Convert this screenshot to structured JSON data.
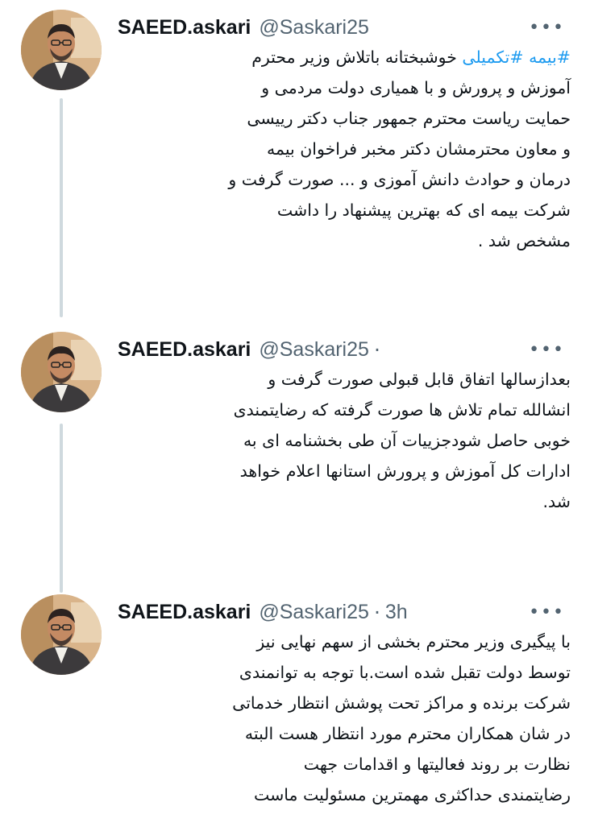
{
  "tweets": [
    {
      "author_name": "SAEED.askari",
      "handle": "@Saskari25",
      "separator": "",
      "time": "",
      "more_icon": "more-icon",
      "hashtags": [
        "#بیمه",
        "#تکمیلی"
      ],
      "lines": [
        "خوشبختانه باتلاش وزیر محترم",
        "آموزش و پرورش و با همیاری دولت مردمی و",
        "حمایت ریاست محترم جمهور جناب دکتر رییسی",
        "و معاون محترمشان دکتر مخبر فراخوان بیمه",
        "درمان و حوادث دانش آموزی و ... صورت گرفت و",
        "شرکت بیمه ای که بهترین پیشنهاد را داشت",
        "مشخص شد ."
      ]
    },
    {
      "author_name": "SAEED.askari",
      "handle": "@Saskari25",
      "separator": "·",
      "time": "",
      "more_icon": "more-icon",
      "lines": [
        "بعدازسالها اتفاق قابل قبولی صورت گرفت و",
        "انشالله تمام تلاش ها صورت گرفته که رضایتمندی",
        "خوبی حاصل شودجزییات آن طی بخشنامه ای به",
        "ادارات کل آموزش و پرورش استانها اعلام خواهد",
        "شد."
      ]
    },
    {
      "author_name": "SAEED.askari",
      "handle": "@Saskari25",
      "separator": "·",
      "time": "3h",
      "more_icon": "more-icon",
      "lines": [
        "با پیگیری وزیر محترم بخشی از سهم نهایی نیز",
        "توسط دولت تقبل شده است.با توجه به توانمندی",
        "شرکت برنده و مراکز تحت پوشش انتظار خدماتی",
        "در شان همکاران محترم مورد انتظار هست البته",
        "نظارت بر روند فعالیتها و اقدامات جهت",
        "رضایتمندی حداکثری مهمترین مسئولیت ماست"
      ]
    }
  ]
}
